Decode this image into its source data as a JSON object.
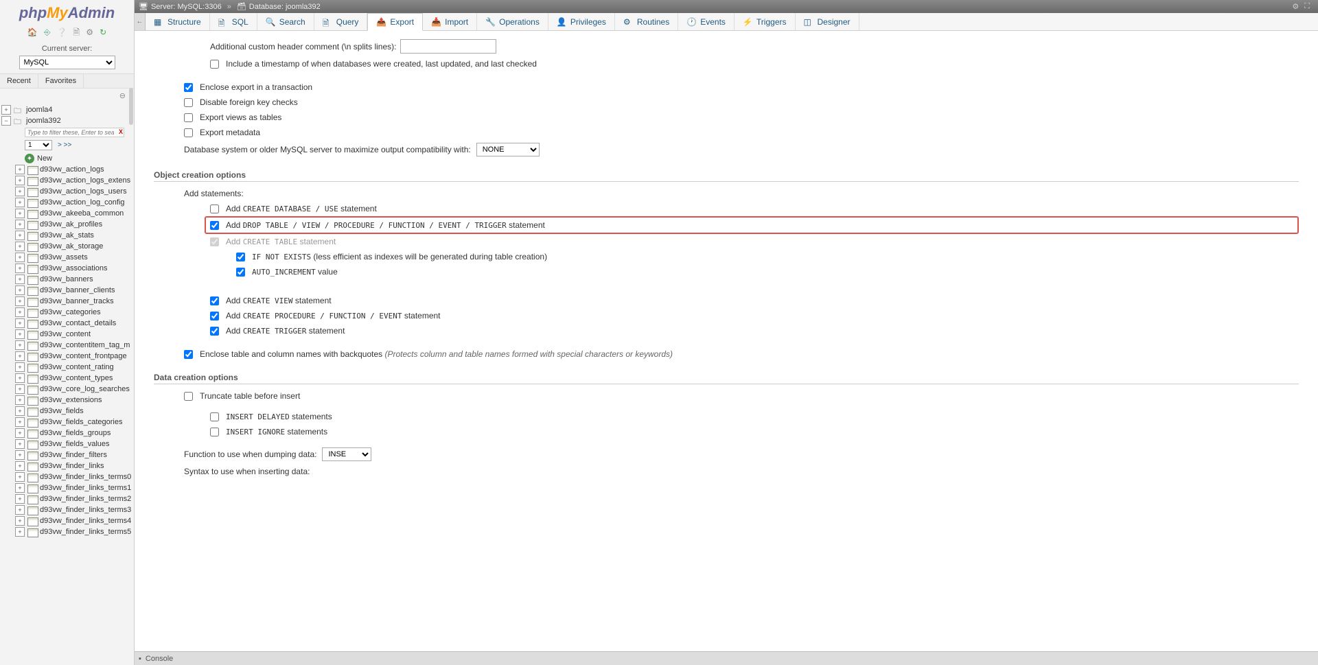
{
  "breadcrumb": {
    "server_label": "Server: MySQL:3306",
    "db_label": "Database: joomla392"
  },
  "sidebar": {
    "logo_php": "php",
    "logo_my": "My",
    "logo_admin": "Admin",
    "current_server_label": "Current server:",
    "server_selected": "MySQL",
    "recent": "Recent",
    "favorites": "Favorites",
    "db1": "joomla4",
    "db2": "joomla392",
    "filter_placeholder": "Type to filter these, Enter to search",
    "page_selected": "1",
    "page_next": "> >>",
    "new_label": "New",
    "tables": [
      "d93vw_action_logs",
      "d93vw_action_logs_extens",
      "d93vw_action_logs_users",
      "d93vw_action_log_config",
      "d93vw_akeeba_common",
      "d93vw_ak_profiles",
      "d93vw_ak_stats",
      "d93vw_ak_storage",
      "d93vw_assets",
      "d93vw_associations",
      "d93vw_banners",
      "d93vw_banner_clients",
      "d93vw_banner_tracks",
      "d93vw_categories",
      "d93vw_contact_details",
      "d93vw_content",
      "d93vw_contentitem_tag_m",
      "d93vw_content_frontpage",
      "d93vw_content_rating",
      "d93vw_content_types",
      "d93vw_core_log_searches",
      "d93vw_extensions",
      "d93vw_fields",
      "d93vw_fields_categories",
      "d93vw_fields_groups",
      "d93vw_fields_values",
      "d93vw_finder_filters",
      "d93vw_finder_links",
      "d93vw_finder_links_terms0",
      "d93vw_finder_links_terms1",
      "d93vw_finder_links_terms2",
      "d93vw_finder_links_terms3",
      "d93vw_finder_links_terms4",
      "d93vw_finder_links_terms5"
    ]
  },
  "tabs": {
    "structure": "Structure",
    "sql": "SQL",
    "search": "Search",
    "query": "Query",
    "export": "Export",
    "import": "Import",
    "operations": "Operations",
    "privileges": "Privileges",
    "routines": "Routines",
    "events": "Events",
    "triggers": "Triggers",
    "designer": "Designer"
  },
  "form": {
    "custom_header_label": "Additional custom header comment (\\n splits lines):",
    "include_timestamp": "Include a timestamp of when databases were created, last updated, and last checked",
    "enclose_txn": "Enclose export in a transaction",
    "disable_fk": "Disable foreign key checks",
    "export_views_tables": "Export views as tables",
    "export_metadata": "Export metadata",
    "compat_label": "Database system or older MySQL server to maximize output compatibility with:",
    "compat_value": "NONE",
    "heading_obj": "Object creation options",
    "add_statements": "Add statements:",
    "add_create_db_pre": "Add ",
    "add_create_db_sc": "CREATE DATABASE / USE",
    "add_create_db_post": " statement",
    "add_drop_pre": "Add ",
    "add_drop_sc": "DROP TABLE / VIEW / PROCEDURE / FUNCTION / EVENT / TRIGGER",
    "add_drop_post": " statement",
    "add_create_tbl_pre": "Add ",
    "add_create_tbl_sc": "CREATE TABLE",
    "add_create_tbl_post": " statement",
    "if_not_exists_sc": "IF NOT EXISTS",
    "if_not_exists_post": " (less efficient as indexes will be generated during table creation)",
    "auto_inc_sc": "AUTO_INCREMENT",
    "auto_inc_post": " value",
    "add_create_view_pre": "Add ",
    "add_create_view_sc": "CREATE VIEW",
    "add_create_view_post": " statement",
    "add_create_proc_pre": "Add ",
    "add_create_proc_sc": "CREATE PROCEDURE / FUNCTION / EVENT",
    "add_create_proc_post": " statement",
    "add_create_trig_pre": "Add ",
    "add_create_trig_sc": "CREATE TRIGGER",
    "add_create_trig_post": " statement",
    "backquotes": "Enclose table and column names with backquotes ",
    "backquotes_note": "(Protects column and table names formed with special characters or keywords)",
    "heading_data": "Data creation options",
    "truncate": "Truncate table before insert",
    "insert_delayed_sc": "INSERT DELAYED",
    "insert_delayed_post": " statements",
    "insert_ignore_sc": "INSERT IGNORE",
    "insert_ignore_post": " statements",
    "dump_func_label": "Function to use when dumping data:",
    "dump_func_value": "INSERT",
    "syntax_label": "Syntax to use when inserting data:"
  },
  "console": {
    "label": "Console"
  }
}
